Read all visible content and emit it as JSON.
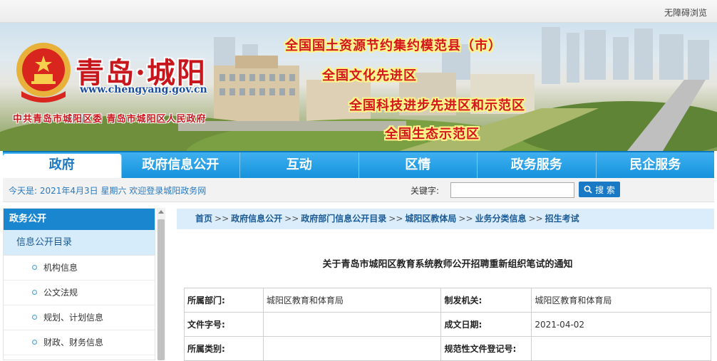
{
  "topbar": {
    "accessibility": "无障碍浏览"
  },
  "banner": {
    "site_name": "青岛·城阳",
    "site_url": "www.chengyang.gov.cn",
    "subtitle": "中共青岛市城阳区委  青岛市城阳区人民政府",
    "slogans": [
      "全国国土资源节约集约模范县（市）",
      "全国文化先进区",
      "全国科技进步先进区和示范区",
      "全国生态示范区"
    ]
  },
  "nav": {
    "items": [
      {
        "label": "政府"
      },
      {
        "label": "政府信息公开"
      },
      {
        "label": "互动"
      },
      {
        "label": "区情"
      },
      {
        "label": "政务服务"
      },
      {
        "label": "民企服务"
      }
    ]
  },
  "infobar": {
    "today": "今天是:   2021年4月3日  星期六  欢迎登录城阳政务网",
    "keyword_label": "关键字:",
    "keyword_value": "",
    "search_label": "搜 索"
  },
  "sidebar": {
    "header": "政务公开",
    "category": "信息公开目录",
    "items": [
      "机构信息",
      "公文法规",
      "规划、计划信息",
      "财政、财务信息"
    ]
  },
  "breadcrumb": [
    "首页",
    "政府信息公开",
    "政府部门信息公开目录",
    "城阳区教体局",
    "业务分类信息",
    "招生考试"
  ],
  "document": {
    "title": "关于青岛市城阳区教育系统教师公开招聘重新组织笔试的通知",
    "rows": [
      [
        "所属部门:",
        "城阳区教育和体育局",
        "制发机关:",
        "城阳区教育和体育局"
      ],
      [
        "文件字号:",
        "",
        "成文日期:",
        "2021-04-02"
      ],
      [
        "所属类别:",
        "",
        "规范性文件登记号:",
        ""
      ]
    ]
  },
  "colors": {
    "nav_blue": "#1692dc",
    "brand_red": "#c8161d",
    "link_blue": "#1a5a95"
  }
}
